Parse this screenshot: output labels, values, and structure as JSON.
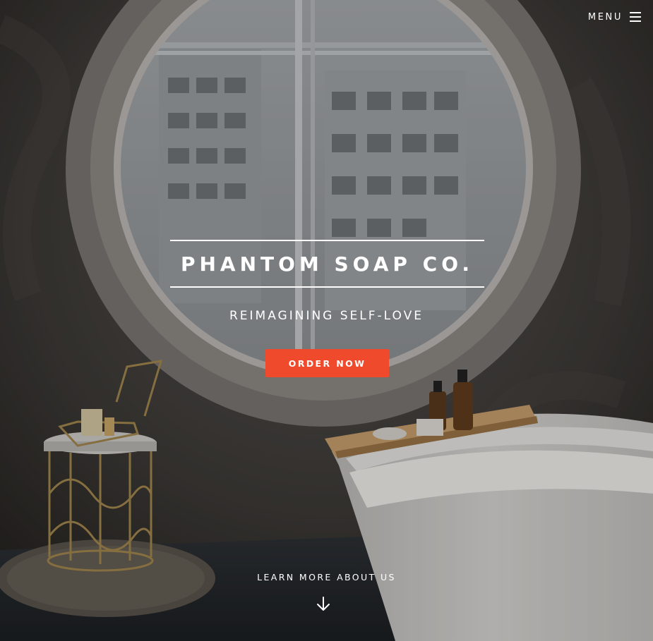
{
  "header": {
    "menu_label": "MENU",
    "menu_icon": "hamburger-icon"
  },
  "hero": {
    "title": "PHANTOM SOAP CO.",
    "tagline": "REIMAGINING SELF-LOVE",
    "cta_label": "ORDER NOW",
    "learn_more_label": "LEARN MORE ABOUT US",
    "learn_more_icon": "arrow-down-icon"
  },
  "colors": {
    "accent": "#f04a2d",
    "text": "#ffffff"
  }
}
